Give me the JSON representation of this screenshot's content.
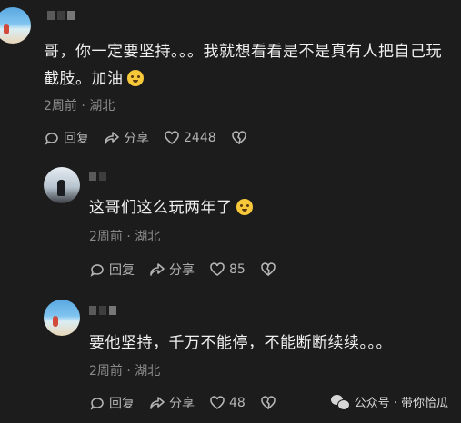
{
  "comments": [
    {
      "text": "哥，你一定要坚持。。。我就想看看是不是真有人把自己玩截肢。加油",
      "meta": "2周前 · 湖北",
      "reply": "回复",
      "share": "分享",
      "likes": "2448"
    },
    {
      "text": "这哥们这么玩两年了",
      "meta": "2周前 · 湖北",
      "reply": "回复",
      "share": "分享",
      "likes": "85"
    },
    {
      "text": "要他坚持，千万不能停，不能断断续续。。。",
      "meta": "2周前 · 湖北",
      "reply": "回复",
      "share": "分享",
      "likes": "48"
    }
  ],
  "watermark": "公众号 · 带你恰瓜"
}
